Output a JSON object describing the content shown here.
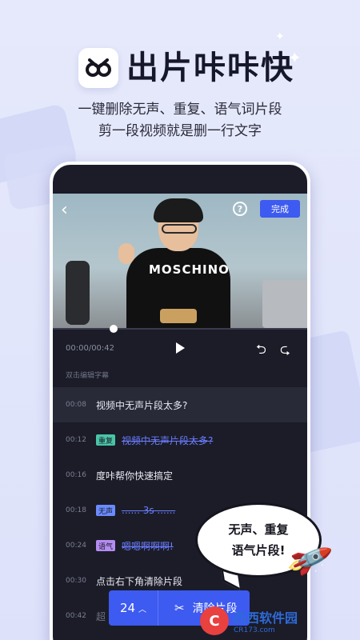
{
  "header": {
    "brand_title": "出片咔咔快",
    "tagline_1": "一键删除无声、重复、语气词片段",
    "tagline_2": "剪一段视频就是删一行文字"
  },
  "video": {
    "done_label": "完成",
    "help_icon": "?",
    "shirt_text": "MOSCHINO",
    "playback_progress": 0.24
  },
  "controls": {
    "time": "00:00/00:42"
  },
  "hint": "双击编辑字幕",
  "subtitles": [
    {
      "time": "00:08",
      "text": "视频中无声片段太多?"
    },
    {
      "time": "00:12",
      "tag": "重复",
      "text": "视频中无声片段太多?"
    },
    {
      "time": "00:16",
      "text": "度咔帮你快速搞定"
    },
    {
      "time": "00:18",
      "tag": "无声",
      "text": "...... 3s ......"
    },
    {
      "time": "00:24",
      "tag": "语气",
      "text": "嗯嗯啊啊啊!"
    },
    {
      "time": "00:30",
      "text": "点击右下角清除片段"
    },
    {
      "time": "00:42",
      "text": "超"
    }
  ],
  "bottom_bar": {
    "count": "24",
    "clean_label": "清除片段"
  },
  "bubble": {
    "line1": "无声、重复",
    "line2": "语气片段!"
  },
  "watermark": {
    "name": "西西软件园",
    "url": "CR173.com"
  },
  "colors": {
    "accent": "#3d5af1",
    "repeat_tag": "#49c5a7",
    "silent_tag": "#6b8cff",
    "tone_tag": "#b58cf2"
  }
}
